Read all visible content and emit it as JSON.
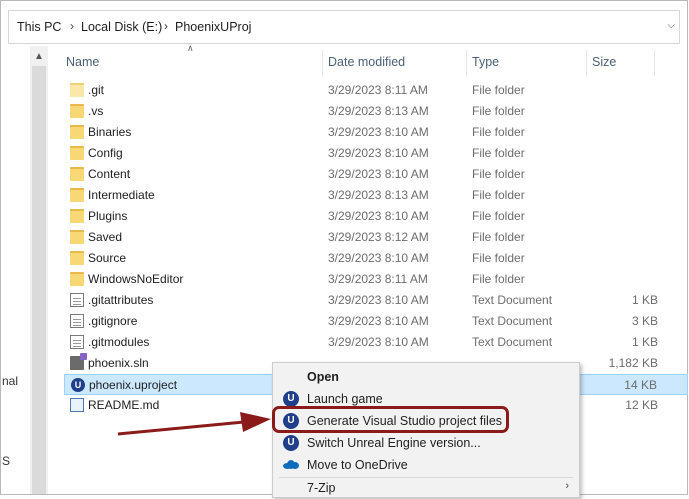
{
  "breadcrumb": {
    "items": [
      "This PC",
      "Local Disk (E:)",
      "PhoenixUProj"
    ]
  },
  "nav_fragments": [
    "nal",
    "S"
  ],
  "columns": {
    "name": "Name",
    "date": "Date modified",
    "type": "Type",
    "size": "Size"
  },
  "files": [
    {
      "name": ".git",
      "date": "3/29/2023 8:11 AM",
      "type": "File folder",
      "size": "",
      "icon": "folder-icon"
    },
    {
      "name": ".vs",
      "date": "3/29/2023 8:13 AM",
      "type": "File folder",
      "size": "",
      "icon": "folder-icon"
    },
    {
      "name": "Binaries",
      "date": "3/29/2023 8:10 AM",
      "type": "File folder",
      "size": "",
      "icon": "folder-icon"
    },
    {
      "name": "Config",
      "date": "3/29/2023 8:10 AM",
      "type": "File folder",
      "size": "",
      "icon": "folder-icon"
    },
    {
      "name": "Content",
      "date": "3/29/2023 8:10 AM",
      "type": "File folder",
      "size": "",
      "icon": "folder-icon"
    },
    {
      "name": "Intermediate",
      "date": "3/29/2023 8:13 AM",
      "type": "File folder",
      "size": "",
      "icon": "folder-icon"
    },
    {
      "name": "Plugins",
      "date": "3/29/2023 8:10 AM",
      "type": "File folder",
      "size": "",
      "icon": "folder-icon"
    },
    {
      "name": "Saved",
      "date": "3/29/2023 8:12 AM",
      "type": "File folder",
      "size": "",
      "icon": "folder-icon"
    },
    {
      "name": "Source",
      "date": "3/29/2023 8:10 AM",
      "type": "File folder",
      "size": "",
      "icon": "folder-icon"
    },
    {
      "name": "WindowsNoEditor",
      "date": "3/29/2023 8:11 AM",
      "type": "File folder",
      "size": "",
      "icon": "folder-icon"
    },
    {
      "name": ".gitattributes",
      "date": "3/29/2023 8:10 AM",
      "type": "Text Document",
      "size": "1 KB",
      "icon": "text-document-icon"
    },
    {
      "name": ".gitignore",
      "date": "3/29/2023 8:10 AM",
      "type": "Text Document",
      "size": "3 KB",
      "icon": "text-document-icon"
    },
    {
      "name": ".gitmodules",
      "date": "3/29/2023 8:10 AM",
      "type": "Text Document",
      "size": "1 KB",
      "icon": "text-document-icon"
    },
    {
      "name": "phoenix.sln",
      "date": "",
      "type": "",
      "size": "1,182 KB",
      "icon": "visual-studio-solution-icon"
    },
    {
      "name": "phoenix.uproject",
      "date": "",
      "type": "",
      "size": "14 KB",
      "icon": "unreal-engine-icon",
      "selected": true
    },
    {
      "name": "README.md",
      "date": "",
      "type": "",
      "size": "12 KB",
      "icon": "markdown-file-icon"
    }
  ],
  "context_menu": {
    "open": "Open",
    "launch": "Launch game",
    "generate": "Generate Visual Studio project files",
    "switch": "Switch Unreal Engine version...",
    "onedrive": "Move to OneDrive",
    "zip": "7-Zip"
  },
  "colors": {
    "accent_selection": "#cce8ff",
    "highlight_outline": "#8b1a1a",
    "folder": "#f8d775"
  }
}
